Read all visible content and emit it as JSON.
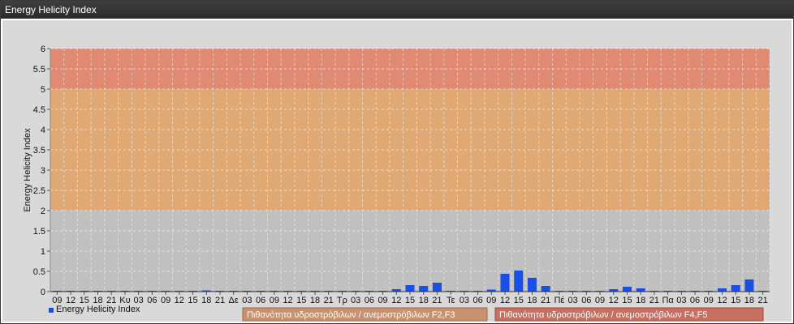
{
  "window": {
    "title": "Energy Helicity Index"
  },
  "colors": {
    "panel_bg": "#d9d9d9",
    "band_low": "#bdbdbd",
    "band_mid": "#e0a060",
    "band_high": "#e07a60",
    "bar": "#1a4fe6",
    "legend_f23_bg": "#c89270",
    "legend_f45_bg": "#c87060"
  },
  "chart_data": {
    "type": "bar",
    "title": "",
    "xlabel": "",
    "ylabel": "Energy Helicity Index",
    "ylim": [
      0,
      6
    ],
    "yticks": [
      "0",
      "0.5",
      "1",
      "1.5",
      "2",
      "2.5",
      "3",
      "3.5",
      "4",
      "4.5",
      "5",
      "5.5",
      "6"
    ],
    "grid": true,
    "legend_position": "bottom-left",
    "bands": [
      {
        "from": 0,
        "to": 2,
        "label": ""
      },
      {
        "from": 2,
        "to": 5,
        "label": "Πιθανότητα υδροστρόβιλων / ανεμοστρόβιλων F2,F3"
      },
      {
        "from": 5,
        "to": 6,
        "label": "Πιθανότητα υδροστρόβιλων / ανεμοστρόβιλων F4,F5"
      }
    ],
    "categories": [
      "09",
      "12",
      "15",
      "18",
      "21",
      "Κυ",
      "03",
      "06",
      "09",
      "12",
      "15",
      "18",
      "21",
      "Δε",
      "03",
      "06",
      "09",
      "12",
      "15",
      "18",
      "21",
      "Τρ",
      "03",
      "06",
      "09",
      "12",
      "15",
      "18",
      "21",
      "Τε",
      "03",
      "06",
      "09",
      "12",
      "15",
      "18",
      "21",
      "Πέ",
      "03",
      "06",
      "09",
      "12",
      "15",
      "18",
      "21",
      "Πα",
      "03",
      "06",
      "09",
      "12",
      "15",
      "18",
      "21"
    ],
    "series": [
      {
        "name": "Energy Helicity Index",
        "values": [
          0.02,
          0.02,
          0.02,
          0.02,
          0.02,
          0.02,
          0.02,
          0.02,
          0.02,
          0.02,
          0.02,
          0.03,
          0.02,
          0.02,
          0.02,
          0.02,
          0.02,
          0.02,
          0.02,
          0.02,
          0.02,
          0.02,
          0.02,
          0.02,
          0.02,
          0.06,
          0.16,
          0.14,
          0.22,
          0.02,
          0.02,
          0.02,
          0.05,
          0.44,
          0.52,
          0.34,
          0.14,
          0.02,
          0.02,
          0.02,
          0.02,
          0.06,
          0.12,
          0.08,
          0.02,
          0.02,
          0.02,
          0.02,
          0.02,
          0.08,
          0.16,
          0.3,
          0.02
        ]
      }
    ]
  },
  "legend": {
    "series_label": "Energy Helicity Index",
    "band_f23_label": "Πιθανότητα υδροστρόβιλων / ανεμοστρόβιλων F2,F3",
    "band_f45_label": "Πιθανότητα υδροστρόβιλων / ανεμοστρόβιλων F4,F5"
  }
}
